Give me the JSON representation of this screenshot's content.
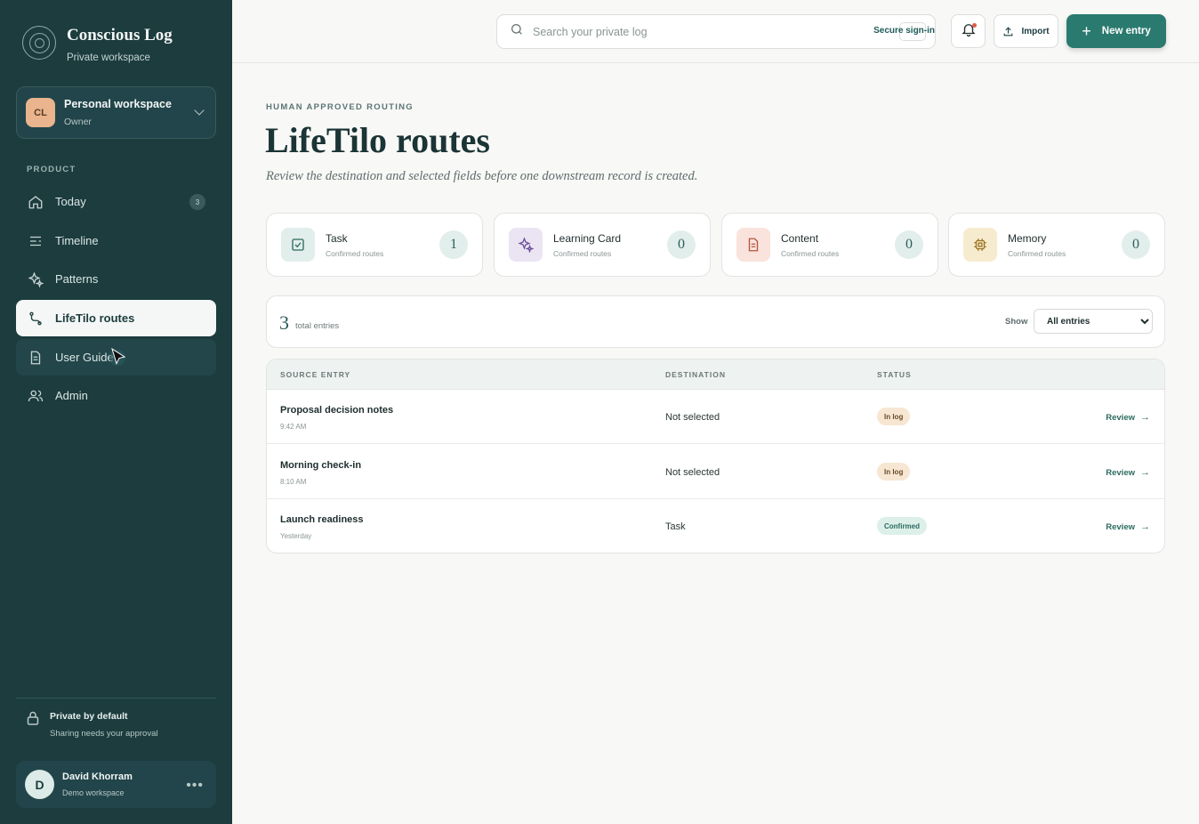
{
  "brand": {
    "title": "Conscious Log",
    "subtitle": "Private workspace"
  },
  "workspace": {
    "initials": "CL",
    "name": "Personal workspace",
    "role": "Owner"
  },
  "nav": {
    "section": "PRODUCT",
    "items": [
      {
        "label": "Today",
        "badge": "3",
        "icon": "home-icon"
      },
      {
        "label": "Timeline",
        "icon": "timeline-icon"
      },
      {
        "label": "Patterns",
        "icon": "sparkle-icon"
      },
      {
        "label": "LifeTilo routes",
        "icon": "route-icon",
        "active": true
      },
      {
        "label": "User Guide",
        "icon": "document-icon"
      },
      {
        "label": "Admin",
        "icon": "users-icon"
      }
    ]
  },
  "privacy": {
    "title": "Private by default",
    "subtitle": "Sharing needs your approval"
  },
  "user": {
    "initial": "D",
    "name": "David Khorram",
    "workspace": "Demo workspace"
  },
  "topbar": {
    "search_placeholder": "Search your private log",
    "secure_label": "Secure sign-in",
    "import_label": "Import",
    "new_entry_label": "New entry"
  },
  "page": {
    "eyebrow": "HUMAN APPROVED ROUTING",
    "title": "LifeTilo routes",
    "subtitle": "Review the destination and selected fields before one downstream record is created."
  },
  "stats": [
    {
      "label": "Task",
      "sub": "Confirmed routes",
      "count": "1",
      "icon": "checkbox-icon",
      "color": "#e2eeeb"
    },
    {
      "label": "Learning Card",
      "sub": "Confirmed routes",
      "count": "0",
      "icon": "sparkle-icon",
      "color": "#ebe4f3"
    },
    {
      "label": "Content",
      "sub": "Confirmed routes",
      "count": "0",
      "icon": "document-icon",
      "color": "#f9e3dc"
    },
    {
      "label": "Memory",
      "sub": "Confirmed routes",
      "count": "0",
      "icon": "chip-icon",
      "color": "#f7ebcf"
    }
  ],
  "filter": {
    "count": "3",
    "label": "total entries",
    "show_label": "Show",
    "selected": "All entries"
  },
  "table": {
    "headers": [
      "SOURCE ENTRY",
      "DESTINATION",
      "STATUS"
    ],
    "rows": [
      {
        "name": "Proposal decision notes",
        "time": "9:42 AM",
        "destination": "Not selected",
        "status": "In log",
        "action": "Review"
      },
      {
        "name": "Morning check-in",
        "time": "8:10 AM",
        "destination": "Not selected",
        "status": "In log",
        "action": "Review"
      },
      {
        "name": "Launch readiness",
        "time": "Yesterday",
        "destination": "Task",
        "status": "Confirmed",
        "action": "Review"
      }
    ]
  }
}
